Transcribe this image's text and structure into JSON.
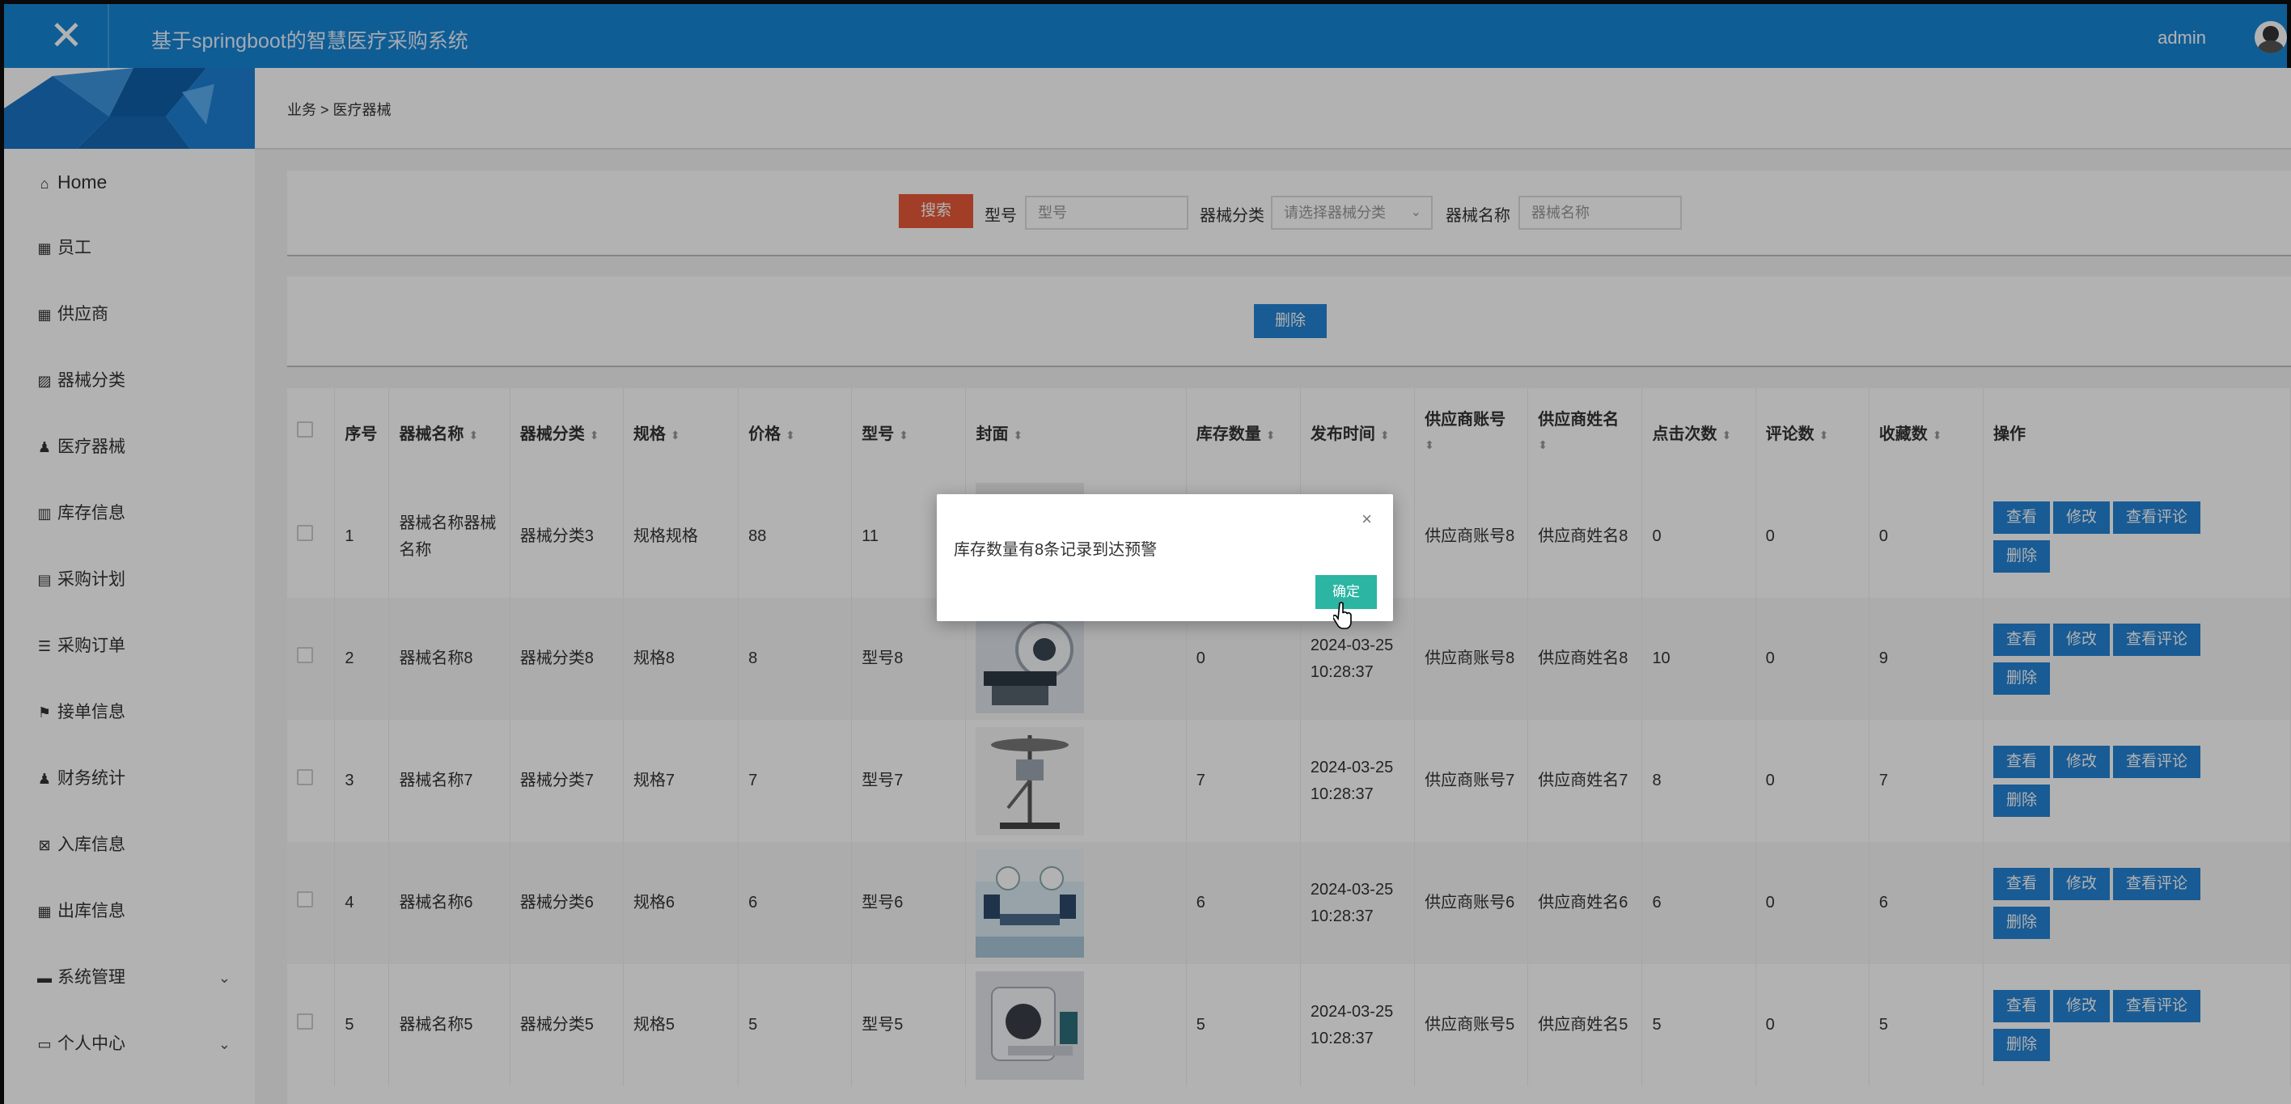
{
  "header": {
    "title": "基于springboot的智慧医疗采购系统",
    "user": "admin",
    "close_icon": "✕"
  },
  "sidebar": {
    "items": [
      {
        "label": "Home",
        "icon": "home-icon",
        "glyph": "⌂"
      },
      {
        "label": "员工",
        "icon": "grid-icon",
        "glyph": "▦"
      },
      {
        "label": "供应商",
        "icon": "grid-icon",
        "glyph": "▦"
      },
      {
        "label": "器械分类",
        "icon": "chart-icon",
        "glyph": "▨"
      },
      {
        "label": "医疗器械",
        "icon": "user-icon",
        "glyph": "♟"
      },
      {
        "label": "库存信息",
        "icon": "bar-chart-icon",
        "glyph": "▥"
      },
      {
        "label": "采购计划",
        "icon": "clipboard-icon",
        "glyph": "▤"
      },
      {
        "label": "采购订单",
        "icon": "list-icon",
        "glyph": "☰"
      },
      {
        "label": "接单信息",
        "icon": "flag-icon",
        "glyph": "⚑"
      },
      {
        "label": "财务统计",
        "icon": "user-icon",
        "glyph": "♟"
      },
      {
        "label": "入库信息",
        "icon": "ticket-icon",
        "glyph": "⊠"
      },
      {
        "label": "出库信息",
        "icon": "grid-icon",
        "glyph": "▦"
      },
      {
        "label": "系统管理",
        "icon": "server-icon",
        "glyph": "▬",
        "expandable": true
      },
      {
        "label": "个人中心",
        "icon": "window-icon",
        "glyph": "▭",
        "expandable": true
      }
    ],
    "chevron": "⌄"
  },
  "breadcrumb": {
    "text": "业务 > 医疗器械"
  },
  "search": {
    "button": "搜索",
    "model_label": "型号",
    "model_placeholder": "型号",
    "category_label": "器械分类",
    "category_placeholder": "请选择器械分类",
    "name_label": "器械名称",
    "name_placeholder": "器械名称"
  },
  "actions": {
    "delete": "删除"
  },
  "table": {
    "headers": [
      "序号",
      "器械名称",
      "器械分类",
      "规格",
      "价格",
      "型号",
      "封面",
      "库存数量",
      "发布时间",
      "供应商账号",
      "供应商姓名",
      "点击次数",
      "评论数",
      "收藏数",
      "操作"
    ],
    "sortable_marker": "⬍",
    "rows": [
      {
        "idx": "1",
        "name": "器械名称器械名称",
        "cat": "器械分类3",
        "spec": "规格规格",
        "price": "88",
        "model": "11",
        "stock": "",
        "time": "",
        "acct": "供应商账号8",
        "sname": "供应商姓名8",
        "clicks": "0",
        "comments": "0",
        "favs": "0",
        "cover": "cover-device-1"
      },
      {
        "idx": "2",
        "name": "器械名称8",
        "cat": "器械分类8",
        "spec": "规格8",
        "price": "8",
        "model": "型号8",
        "stock": "0",
        "time": "2024-03-25 10:28:37",
        "acct": "供应商账号8",
        "sname": "供应商姓名8",
        "clicks": "10",
        "comments": "0",
        "favs": "9",
        "cover": "cover-ct-scanner"
      },
      {
        "idx": "3",
        "name": "器械名称7",
        "cat": "器械分类7",
        "spec": "规格7",
        "price": "7",
        "model": "型号7",
        "stock": "7",
        "time": "2024-03-25 10:28:37",
        "acct": "供应商账号7",
        "sname": "供应商姓名7",
        "clicks": "8",
        "comments": "0",
        "favs": "7",
        "cover": "cover-surgical-lamp"
      },
      {
        "idx": "4",
        "name": "器械名称6",
        "cat": "器械分类6",
        "spec": "规格6",
        "price": "6",
        "model": "型号6",
        "stock": "6",
        "time": "2024-03-25 10:28:37",
        "acct": "供应商账号6",
        "sname": "供应商姓名6",
        "clicks": "6",
        "comments": "0",
        "favs": "6",
        "cover": "cover-operating-room"
      },
      {
        "idx": "5",
        "name": "器械名称5",
        "cat": "器械分类5",
        "spec": "规格5",
        "price": "5",
        "model": "型号5",
        "stock": "5",
        "time": "2024-03-25 10:28:37",
        "acct": "供应商账号5",
        "sname": "供应商姓名5",
        "clicks": "5",
        "comments": "0",
        "favs": "5",
        "cover": "cover-mri-machine"
      }
    ],
    "row_actions": {
      "view": "查看",
      "edit": "修改",
      "view_comments": "查看评论",
      "delete": "删除"
    }
  },
  "dialog": {
    "message": "库存数量有8条记录到达预警",
    "ok": "确定",
    "close": "×"
  },
  "colors": {
    "topbar": "#1686d6",
    "primary_button": "#2483d4",
    "search_button": "#e85a3a",
    "ok_button": "#2bb5a2"
  }
}
